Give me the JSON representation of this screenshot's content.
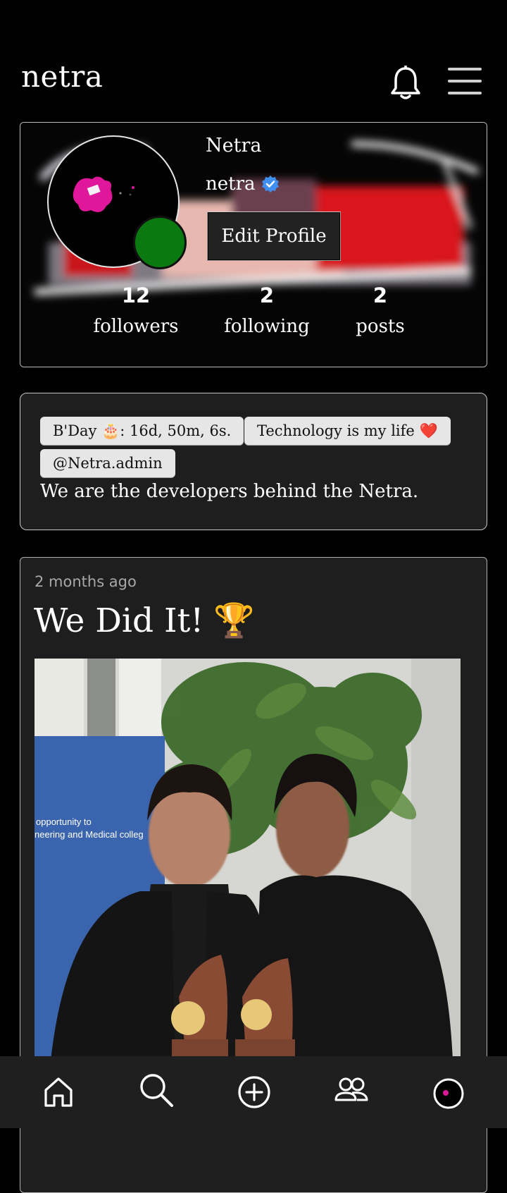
{
  "app": {
    "title": "netra"
  },
  "header": {
    "notification_icon": "bell-icon",
    "menu_icon": "hamburger-menu-icon"
  },
  "profile": {
    "display_name": "Netra",
    "username": "netra",
    "verified": true,
    "edit_button_label": "Edit Profile",
    "online_status_color": "#0a7a10",
    "stats": [
      {
        "value": "12",
        "label": "followers"
      },
      {
        "value": "2",
        "label": "following"
      },
      {
        "value": "2",
        "label": "posts"
      }
    ]
  },
  "bio": {
    "chips": [
      {
        "text": "B'Day 🎂: 16d, 50m, 6s."
      },
      {
        "text": "Technology is my life ❤️"
      },
      {
        "text": "@Netra.admin"
      }
    ],
    "text": "We are the developers behind the Netra."
  },
  "post": {
    "time": "2 months ago",
    "title": "We Did It!",
    "title_emoji": "🏆"
  },
  "bottom_nav": {
    "items": [
      {
        "icon": "home-icon"
      },
      {
        "icon": "search-icon"
      },
      {
        "icon": "add-post-icon"
      },
      {
        "icon": "people-icon"
      },
      {
        "icon": "profile-avatar-icon"
      }
    ]
  },
  "colors": {
    "background": "#000000",
    "card": "#1e1e1e",
    "nav": "#1f1f1f",
    "chip": "#e6e6e6",
    "verified": "#3f8ef0"
  }
}
